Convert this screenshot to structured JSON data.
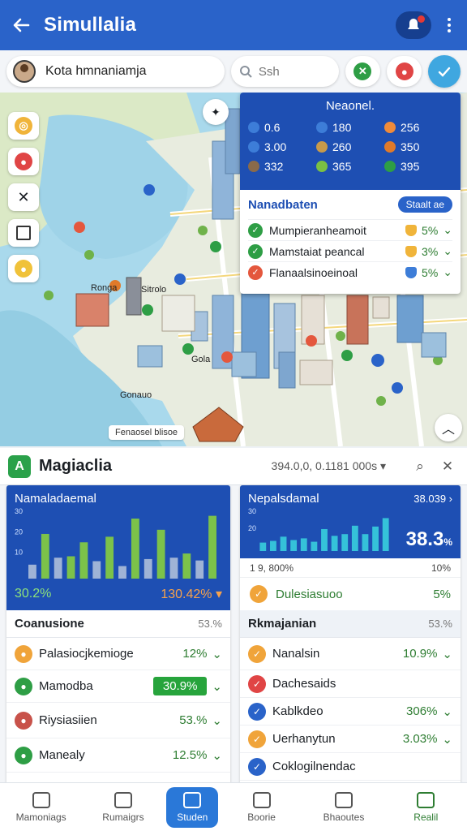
{
  "appbar": {
    "title": "Simullalia",
    "back_icon": "arrow-left-icon",
    "notif_icon": "notification-icon",
    "menu_icon": "more-vertical-icon"
  },
  "searchrow": {
    "user_name": "Kota hmnaniamja",
    "search_placeholder": "Ssh",
    "buttons": [
      "check-icon",
      "pin-icon",
      "checkmark-icon"
    ]
  },
  "map": {
    "caption": "Fenaosel blisoe",
    "labels": [
      "Gonauo",
      "Gola",
      "Ronga",
      "Sitrolo"
    ],
    "tools": [
      "user-location-icon",
      "marker-icon",
      "tools-icon",
      "layers-icon",
      "pin-icon"
    ]
  },
  "overlay": {
    "title": "Neaonel.",
    "stats": [
      "0.6",
      "180",
      "256",
      "3.00",
      "260",
      "350",
      "332",
      "365",
      "395"
    ],
    "stat_colors": [
      "#3d7dd8",
      "#3d7dd8",
      "#f08b3a",
      "#3d7dd8",
      "#c89a4a",
      "#e07a2a",
      "#8a6a4a",
      "#7bc043",
      "#2e9e45"
    ],
    "header": "Nanadbaten",
    "badge": "Staalt ae",
    "rows": [
      {
        "label": "Mumpieranheamoit",
        "value": "5%",
        "check": "#2e9e45",
        "shield": "#f0b43a"
      },
      {
        "label": "Mamstaiat peancal",
        "value": "3%",
        "check": "#2e9e45",
        "shield": "#f0b43a"
      },
      {
        "label": "Flanaalsinoeinoal",
        "value": "5%",
        "check": "#e4573d",
        "shield": "#3d7dd8"
      }
    ]
  },
  "sheet": {
    "title": "Magiaclia",
    "range": "394.0,0, 0.1181 000s",
    "search_icon": "search-icon",
    "close_icon": "close-icon"
  },
  "card1": {
    "chart_title": "Namaladaemal",
    "kpi_left": "30.2%",
    "kpi_right": "130.42%",
    "list_header": "Coanusione",
    "list_header_right": "53.%",
    "items": [
      {
        "label": "Palasiocjkemioge",
        "value": "12%",
        "icon": "#f0a43a",
        "pill": false
      },
      {
        "label": "Mamodba",
        "value": "30.9%",
        "icon": "#2e9e45",
        "pill": true
      },
      {
        "label": "Riysiasiien",
        "value": "53.%",
        "icon": "#c8524a",
        "pill": false
      },
      {
        "label": "Manealy",
        "value": "12.5%",
        "icon": "#2e9e45",
        "pill": false
      }
    ]
  },
  "card2": {
    "chart_title": "Nepalsdamal",
    "chart_top_right": "38.039",
    "kpi_big": "38.3",
    "kpi_unit": "%",
    "mini_left": "1 9, 800%",
    "mini_right": "10%",
    "sub_label": "Dulesiasuoo",
    "sub_value": "5%",
    "list_header": "Rkmajanian",
    "list_header_right": "53.%",
    "items": [
      {
        "label": "Nanalsin",
        "value": "10.9%",
        "icon": "#f0a43a"
      },
      {
        "label": "Dachesaids",
        "value": "",
        "icon": "#e04545"
      },
      {
        "label": "Kablkdeo",
        "value": "306%",
        "icon": "#2a63c9"
      },
      {
        "label": "Uerhanytun",
        "value": "3.03%",
        "icon": "#f0a43a"
      },
      {
        "label": "Coklogilnendac",
        "value": "",
        "icon": "#2a63c9"
      }
    ]
  },
  "chart_data": [
    {
      "type": "bar",
      "title": "Namaladaemal",
      "ylim": [
        0,
        100
      ],
      "ticks": [
        "30",
        "20",
        "10"
      ],
      "categories": [
        "1",
        "2",
        "3",
        "4",
        "5",
        "6",
        "7",
        "8",
        "9",
        "10",
        "11",
        "12",
        "13",
        "14",
        "15"
      ],
      "series": [
        {
          "values": [
            20,
            0,
            30,
            0,
            0,
            25,
            0,
            18,
            0,
            28,
            0,
            30,
            0,
            26,
            0
          ]
        },
        {
          "values": [
            0,
            64,
            0,
            32,
            52,
            0,
            60,
            0,
            86,
            0,
            70,
            0,
            36,
            0,
            90
          ]
        }
      ]
    },
    {
      "type": "bar",
      "title": "Nepalsdamal",
      "ylim": [
        0,
        100
      ],
      "ticks": [
        "30",
        "20"
      ],
      "categories": [
        "1",
        "2",
        "3",
        "4",
        "5",
        "6",
        "7",
        "8",
        "9",
        "10",
        "11",
        "12",
        "13"
      ],
      "series": [
        {
          "values": [
            20,
            24,
            34,
            26,
            30,
            22,
            52,
            36,
            40,
            60,
            40,
            58,
            78
          ]
        }
      ]
    }
  ],
  "nav": [
    {
      "label": "Mamoniags",
      "active": false
    },
    {
      "label": "Rumaigrs",
      "active": false
    },
    {
      "label": "Studen",
      "active": true
    },
    {
      "label": "Boorie",
      "active": false
    },
    {
      "label": "Bhaoutes",
      "active": false
    },
    {
      "label": "Realil",
      "active": false
    }
  ],
  "colors": {
    "primary": "#2a63c9",
    "primary_dark": "#1e4fb3",
    "success": "#2e7d32",
    "accent": "#3fa7e0"
  }
}
